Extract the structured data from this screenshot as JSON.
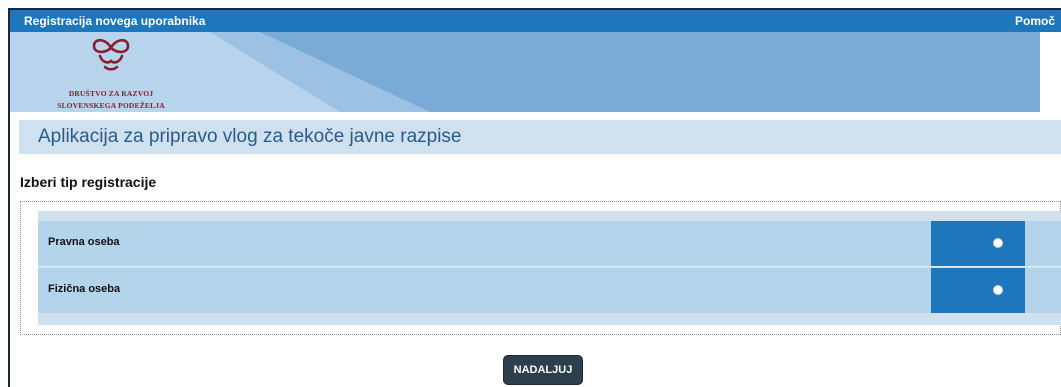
{
  "topbar": {
    "title": "Registracija novega uporabnika",
    "help": "Pomoč"
  },
  "banner": {
    "logo_line1": "DRUŠTVO ZA RAZVOJ",
    "logo_line2": "SLOVENSKEGA PODEŽELJA",
    "logo_icon": "knot-logo-icon"
  },
  "app_title": "Aplikacija za pripravo vlog za tekoče javne razpise",
  "section_heading": "Izberi tip registracije",
  "options": [
    {
      "label": "Pravna oseba",
      "selected": false
    },
    {
      "label": "Fizična oseba",
      "selected": false
    }
  ],
  "continue_button": "NADALJUJ",
  "colors": {
    "topbar": "#1e76bd",
    "banner": "#7aaad6",
    "title_band": "#cfe0ee",
    "option_row": "#b4d4ec",
    "radio_cell": "#1e76bd",
    "button": "#2d3f4d",
    "logo": "#8a1d2e"
  }
}
